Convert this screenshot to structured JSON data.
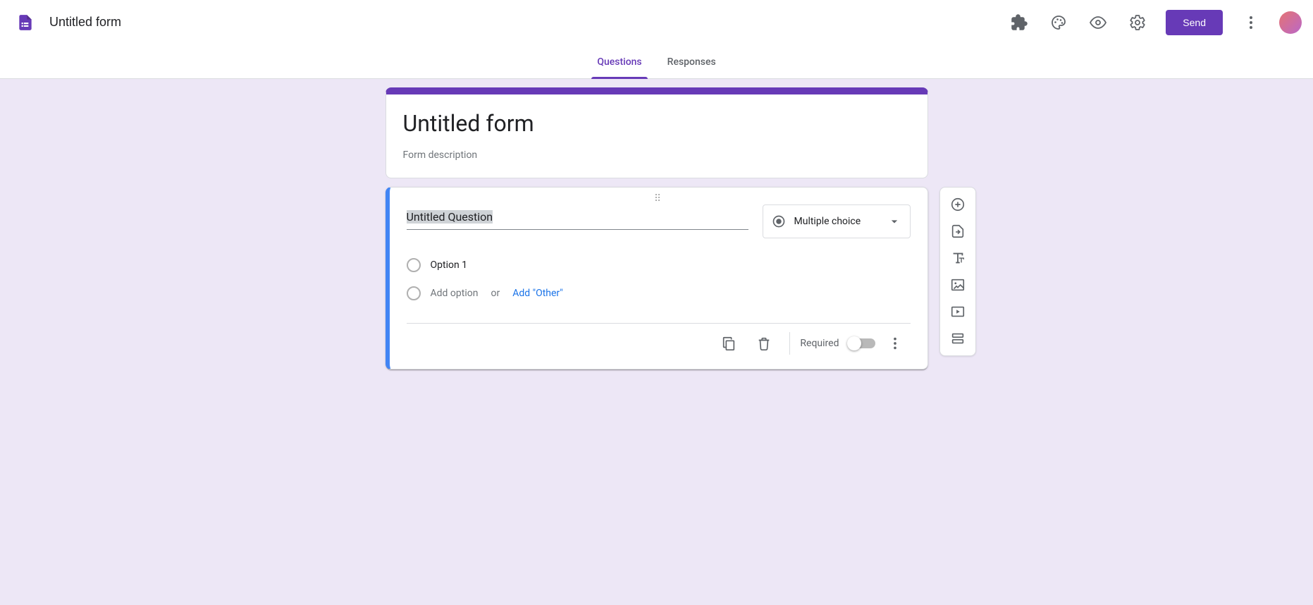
{
  "header": {
    "form_title": "Untitled form",
    "send_label": "Send"
  },
  "tabs": {
    "questions": "Questions",
    "responses": "Responses"
  },
  "title_card": {
    "title": "Untitled form",
    "description_placeholder": "Form description"
  },
  "question": {
    "title": "Untitled Question",
    "type_label": "Multiple choice",
    "options": [
      "Option 1"
    ],
    "add_option_placeholder": "Add option",
    "or_label": "or",
    "add_other_label": "Add \"Other\"",
    "required_label": "Required"
  },
  "colors": {
    "accent": "#673ab7",
    "background": "#ede7f6",
    "selected_border": "#4285f4",
    "link": "#1a73e8"
  },
  "icons": {
    "addons": "puzzle-icon",
    "theme": "palette-icon",
    "preview": "eye-icon",
    "settings": "gear-icon",
    "more": "more-vert-icon",
    "add_question": "plus-circle-icon",
    "import_questions": "import-file-icon",
    "add_title": "text-icon",
    "add_image": "image-icon",
    "add_video": "video-icon",
    "add_section": "section-icon",
    "copy": "copy-icon",
    "delete": "trash-icon",
    "question_more": "more-vert-icon"
  }
}
